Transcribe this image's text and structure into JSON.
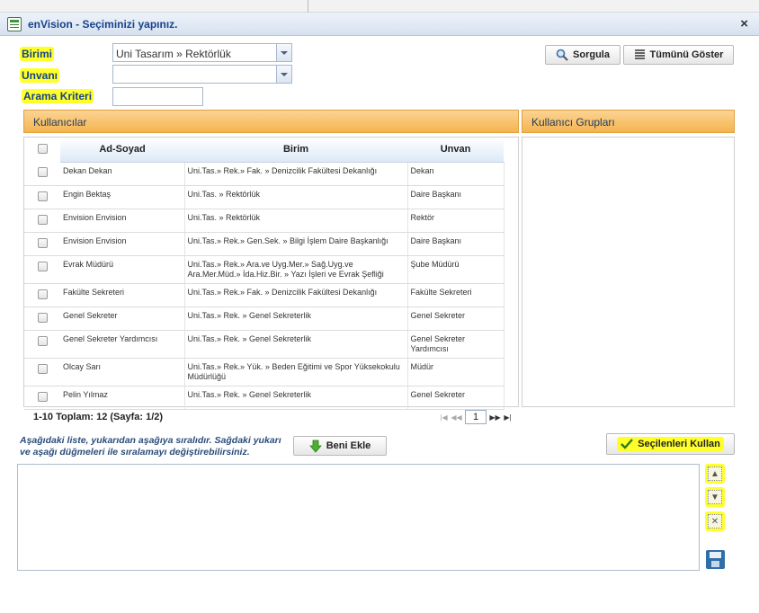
{
  "window": {
    "title": "enVision - Seçiminizi yapınız."
  },
  "form": {
    "birimi_label": "Birimi",
    "birimi_value": "Uni Tasarım » Rektörlük",
    "unvani_label": "Unvanı",
    "unvani_value": "",
    "arama_label": "Arama Kriteri",
    "arama_value": ""
  },
  "toolbar": {
    "sorgula": "Sorgula",
    "tumunu_goster": "Tümünü Göster"
  },
  "users_panel": {
    "title": "Kullanıcılar",
    "columns": [
      "Ad-Soyad",
      "Birim",
      "Unvan"
    ],
    "rows": [
      {
        "name": "Dekan Dekan",
        "birim": "Uni.Tas.» Rek.» Fak. » Denizcilik Fakültesi Dekanlığı",
        "unvan": "Dekan"
      },
      {
        "name": "Engin Bektaş",
        "birim": "Uni.Tas. » Rektörlük",
        "unvan": "Daire Başkanı"
      },
      {
        "name": "Envision Envision",
        "birim": "Uni.Tas. » Rektörlük",
        "unvan": "Rektör"
      },
      {
        "name": "Envision Envision",
        "birim": "Uni.Tas.» Rek.» Gen.Sek. » Bilgi İşlem Daire Başkanlığı",
        "unvan": "Daire Başkanı"
      },
      {
        "name": "Evrak Müdürü",
        "birim": "Uni.Tas.» Rek.» Ara.ve Uyg.Mer.» Sağ.Uyg.ve Ara.Mer.Müd.» İda.Hiz.Bir. » Yazı İşleri ve Evrak Şefliği",
        "unvan": "Şube Müdürü"
      },
      {
        "name": "Fakülte Sekreteri",
        "birim": "Uni.Tas.» Rek.» Fak. » Denizcilik Fakültesi Dekanlığı",
        "unvan": "Fakülte Sekreteri"
      },
      {
        "name": "Genel Sekreter",
        "birim": "Uni.Tas.» Rek. » Genel Sekreterlik",
        "unvan": "Genel Sekreter"
      },
      {
        "name": "Genel Sekreter Yardımcısı",
        "birim": "Uni.Tas.» Rek. » Genel Sekreterlik",
        "unvan": "Genel Sekreter Yardımcısı"
      },
      {
        "name": "Olcay Sarı",
        "birim": "Uni.Tas.» Rek.» Yük. » Beden Eğitimi ve Spor Yüksekokulu Müdürlüğü",
        "unvan": "Müdür"
      },
      {
        "name": "Pelin Yılmaz",
        "birim": "Uni.Tas.» Rek. » Genel Sekreterlik",
        "unvan": "Genel Sekreter"
      }
    ]
  },
  "groups_panel": {
    "title": "Kullanıcı Grupları"
  },
  "paging": {
    "summary": "1-10 Toplam: 12   (Sayfa: 1/2)",
    "current_page": "1"
  },
  "bottom": {
    "info": "Aşağıdaki liste, yukarıdan aşağıya sıralıdır. Sağdaki yukarı ve aşağı düğmeleri ile sıralamayı değiştirebilirsiniz.",
    "beni_ekle": "Beni Ekle",
    "secilenleri_kullan": "Seçilenleri Kullan"
  },
  "icons": {
    "sorgula": "magnifier-icon",
    "tumunu_goster": "list-icon",
    "beni_ekle": "green-down-arrow-icon",
    "secilenleri_kullan": "checkmark-icon",
    "move_up": "arrow-up-icon",
    "move_down": "arrow-down-icon",
    "remove": "delete-icon",
    "save": "floppy-disk-icon"
  },
  "colors": {
    "highlight": "#ffff2a",
    "panel_header": "#f5b44e",
    "title_text": "#15428b"
  }
}
